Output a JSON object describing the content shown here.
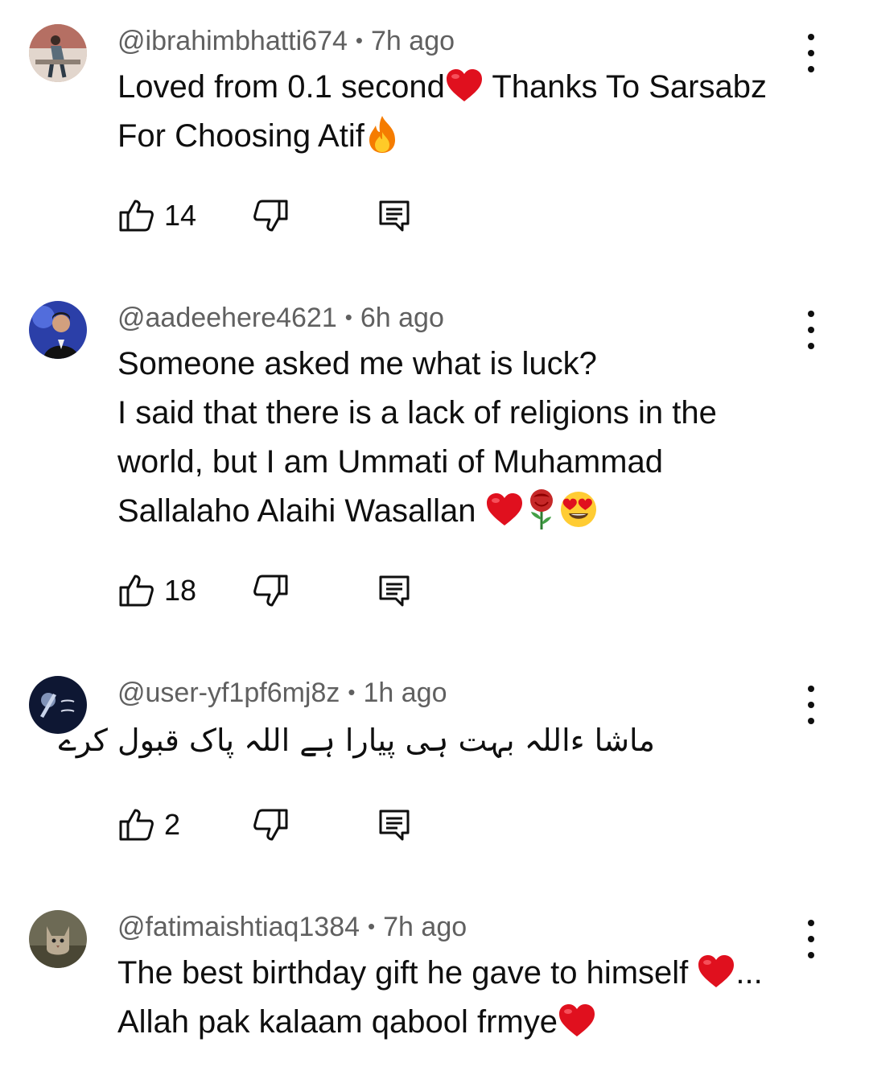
{
  "comments": [
    {
      "handle": "@ibrahimbhatti674",
      "time": "7h ago",
      "lines": [
        "Loved from 0.1 second",
        "For Choosing Atif"
      ],
      "line1_tail": " Thanks To Sarsabz",
      "likes": "14",
      "avatar": "person-photo-avatar"
    },
    {
      "handle": "@aadeehere4621",
      "time": "6h ago",
      "lines": [
        "Someone asked me what is luck?",
        "I said that there is a lack of religions in the",
        "world, but I am Ummati of Muhammad",
        "Sallalaho Alaihi Wasallan "
      ],
      "likes": "18",
      "avatar": "man-on-stage-avatar"
    },
    {
      "handle": "@user-yf1pf6mj8z",
      "time": "1h ago",
      "lines": [
        "ماشا ءاللہ بہت ہی پیارا ہے اللہ پاک قبول کرے"
      ],
      "likes": "2",
      "avatar": "cricket-logo-avatar"
    },
    {
      "handle": "@fatimaishtiaq1384",
      "time": "7h ago",
      "lines": [
        "The best birthday gift he gave to himself ",
        "Allah pak kalaam qabool frmye"
      ],
      "line1_tail": "...",
      "likes": "",
      "avatar": "cat-photo-avatar"
    }
  ],
  "icons": {
    "like": "thumbs-up-icon",
    "dislike": "thumbs-down-icon",
    "reply": "reply-comment-icon",
    "menu": "more-vert-icon",
    "heart": "red-heart-emoji",
    "fire": "fire-emoji",
    "rose": "rose-emoji",
    "heart_eyes": "heart-eyes-emoji"
  },
  "colors": {
    "text": "#0f0f0f",
    "meta": "#606060",
    "heart": "#e0101e"
  }
}
